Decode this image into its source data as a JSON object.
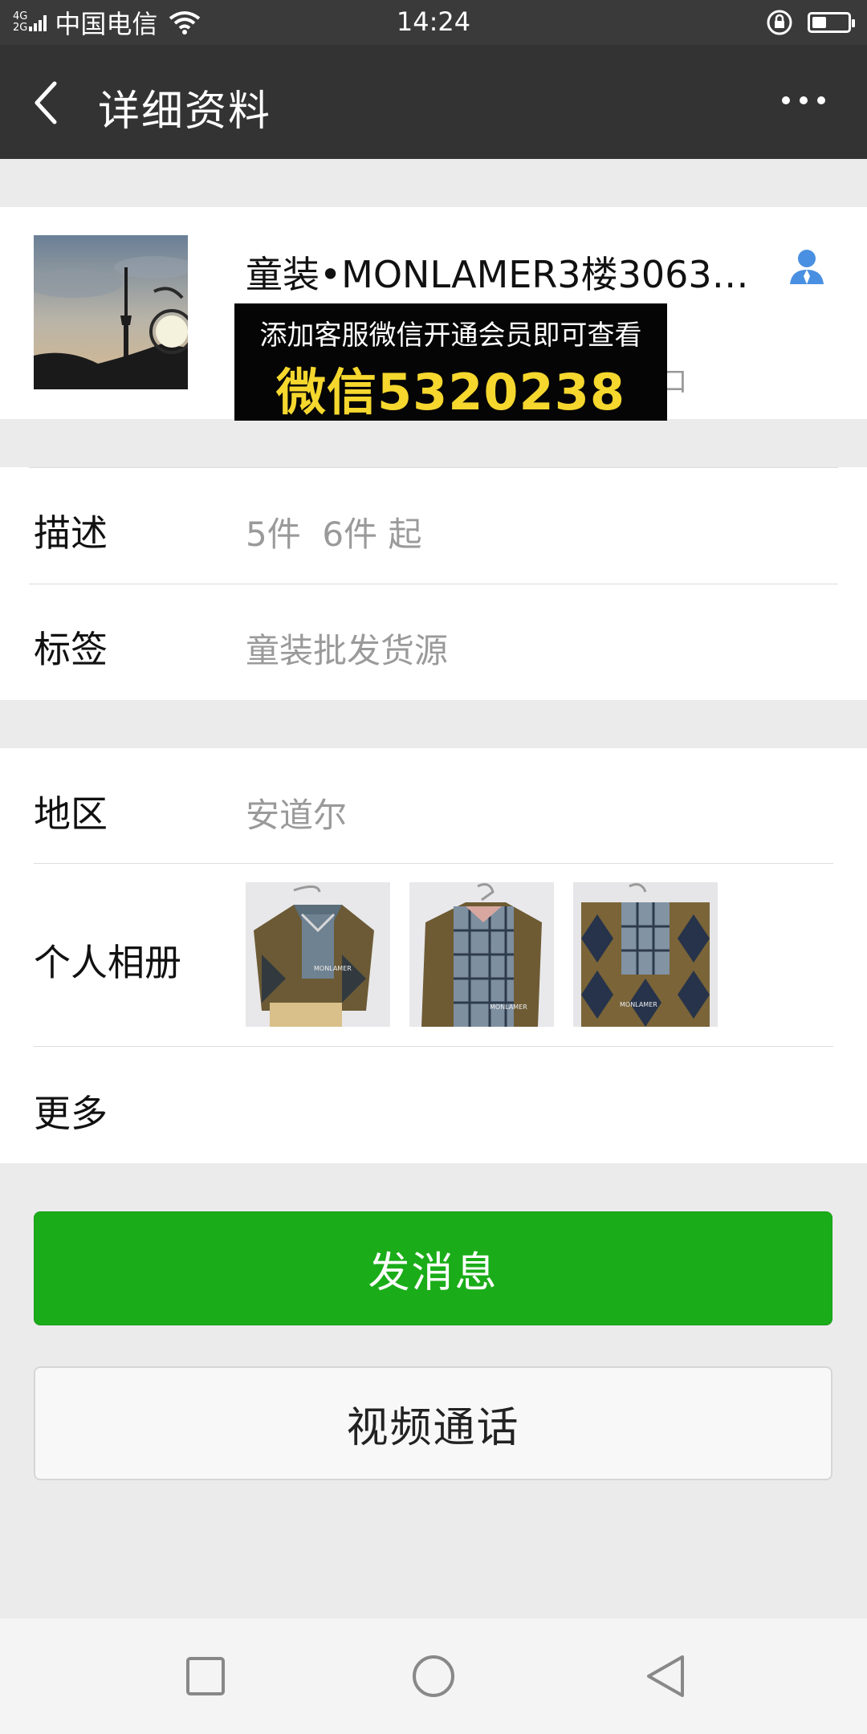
{
  "status_bar": {
    "network_top": "4G",
    "network_bottom": "2G",
    "carrier": "中国电信",
    "time": "14:24",
    "battery_level": 0.4
  },
  "nav": {
    "title": "详细资料"
  },
  "profile": {
    "display_name": "童装•MONLAMER3楼3063档...",
    "promo_line1": "添加客服微信开通会员即可查看",
    "promo_line2": "微信5320238",
    "hidden_glyph": "口"
  },
  "info": {
    "description_label": "描述",
    "description_value": "5件  6件 起",
    "tags_label": "标签",
    "tags_value": "童装批发货源"
  },
  "details": {
    "region_label": "地区",
    "region_value": "安道尔",
    "album_label": "个人相册",
    "album_thumbs": [
      {
        "caption": "MONLAMER"
      },
      {
        "caption": "MONLAMER"
      },
      {
        "caption": "MONLAMER"
      }
    ],
    "more_label": "更多"
  },
  "actions": {
    "send_message": "发消息",
    "video_call": "视频通话"
  },
  "icons": {
    "back": "chevron-left-icon",
    "more": "more-dots-icon",
    "contact": "person-icon",
    "wifi": "wifi-icon",
    "rotation_lock": "rotation-lock-icon",
    "battery": "battery-icon"
  },
  "colors": {
    "nav_bg": "#333333",
    "primary_green": "#1aad19",
    "promo_yellow": "#f5d72e",
    "contact_blue": "#4a90e2"
  }
}
